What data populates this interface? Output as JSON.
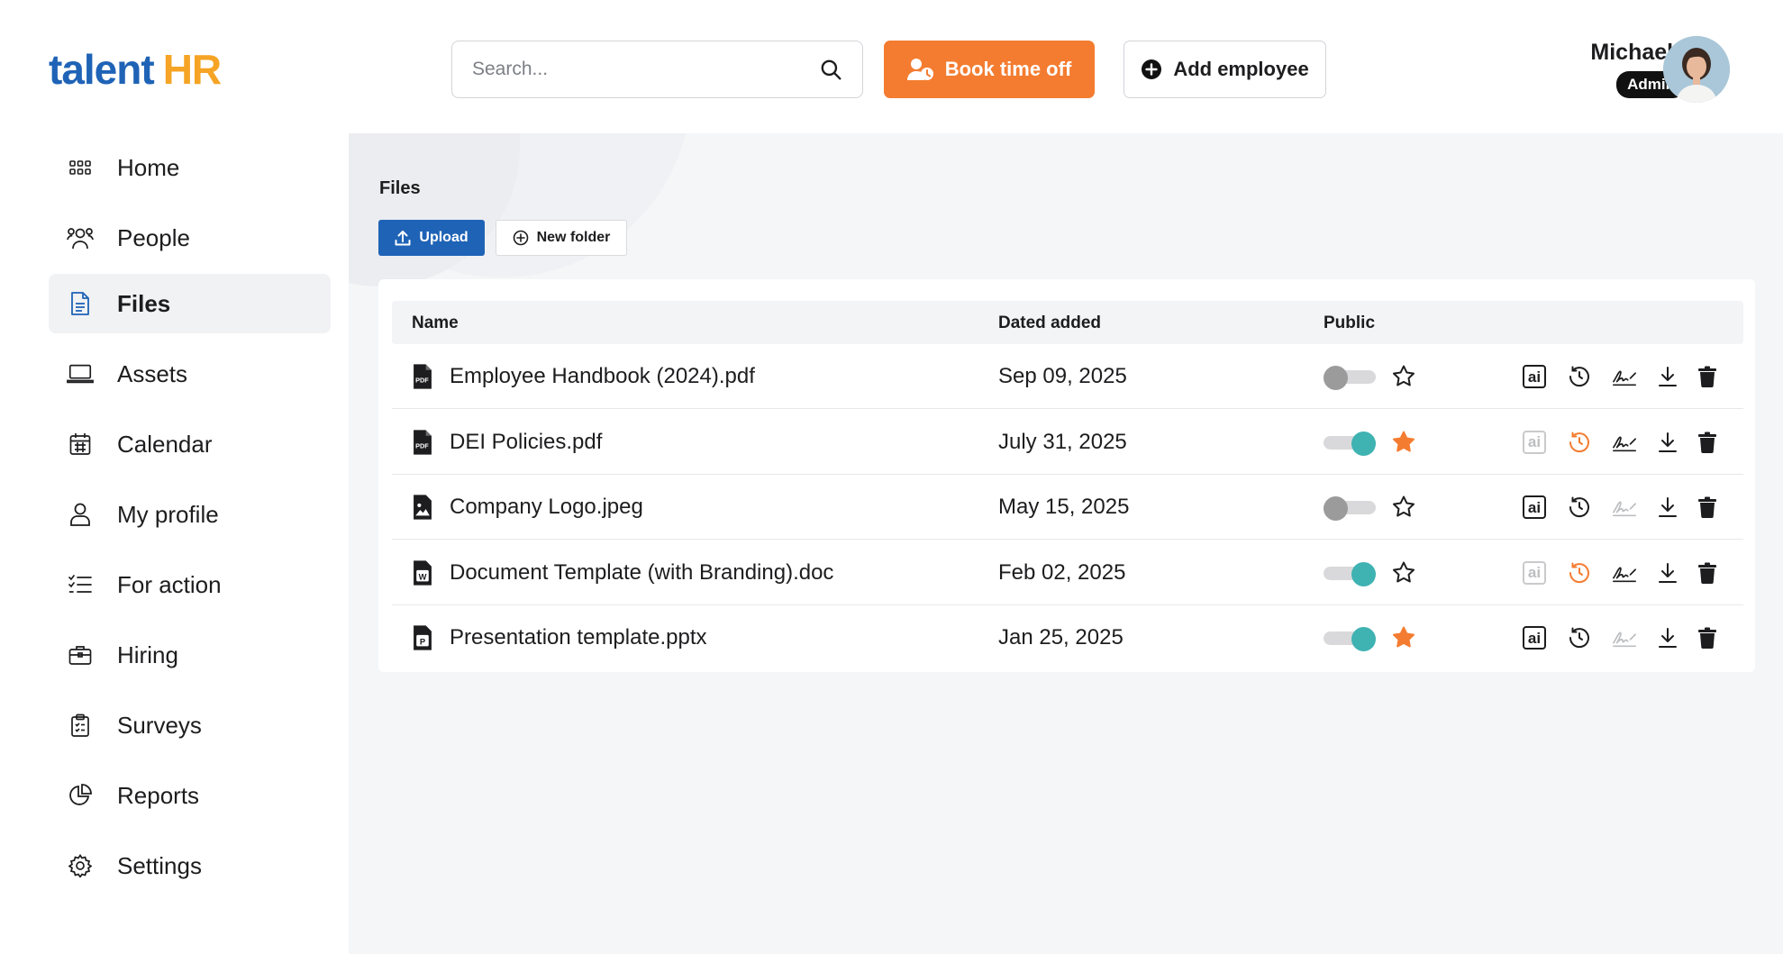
{
  "brand": {
    "name_part1": "talent",
    "name_part2": "HR"
  },
  "search": {
    "placeholder": "Search..."
  },
  "header": {
    "book_label": "Book time off",
    "add_label": "Add employee"
  },
  "user": {
    "name": "Michaela",
    "role": "Admin"
  },
  "sidebar": {
    "items": [
      {
        "label": "Home",
        "icon": "grid-icon"
      },
      {
        "label": "People",
        "icon": "people-icon"
      },
      {
        "label": "Files",
        "icon": "file-icon",
        "active": true
      },
      {
        "label": "Assets",
        "icon": "laptop-icon"
      },
      {
        "label": "Calendar",
        "icon": "calendar-icon"
      },
      {
        "label": "My profile",
        "icon": "user-icon"
      },
      {
        "label": "For action",
        "icon": "checklist-icon"
      },
      {
        "label": "Hiring",
        "icon": "briefcase-icon"
      },
      {
        "label": "Surveys",
        "icon": "clipboard-icon"
      },
      {
        "label": "Reports",
        "icon": "pie-chart-icon"
      },
      {
        "label": "Settings",
        "icon": "gear-icon"
      }
    ]
  },
  "files": {
    "title": "Files",
    "upload_label": "Upload",
    "new_folder_label": "New folder",
    "columns": {
      "name": "Name",
      "date": "Dated added",
      "public": "Public"
    },
    "rows": [
      {
        "name": "Employee Handbook (2024).pdf",
        "date": "Sep 09, 2025",
        "type": "pdf",
        "public": false,
        "starred": false,
        "ai_active": true,
        "history_active": false,
        "signature_active": true
      },
      {
        "name": "DEI Policies.pdf",
        "date": "July 31, 2025",
        "type": "pdf",
        "public": true,
        "starred": true,
        "ai_active": false,
        "history_active": true,
        "signature_active": true
      },
      {
        "name": "Company Logo.jpeg",
        "date": "May 15, 2025",
        "type": "image",
        "public": false,
        "starred": false,
        "ai_active": true,
        "history_active": false,
        "signature_active": false
      },
      {
        "name": "Document Template (with Branding).doc",
        "date": "Feb 02, 2025",
        "type": "word",
        "public": true,
        "starred": false,
        "ai_active": false,
        "history_active": true,
        "signature_active": true
      },
      {
        "name": "Presentation template.pptx",
        "date": "Jan 25, 2025",
        "type": "powerpoint",
        "public": true,
        "starred": true,
        "ai_active": true,
        "history_active": false,
        "signature_active": false
      }
    ]
  },
  "colors": {
    "brand_blue": "#1f63b6",
    "brand_orange": "#f5a425",
    "accent_orange": "#f47c30",
    "toggle_on": "#3fb2b2",
    "star_active": "#f47c30"
  }
}
